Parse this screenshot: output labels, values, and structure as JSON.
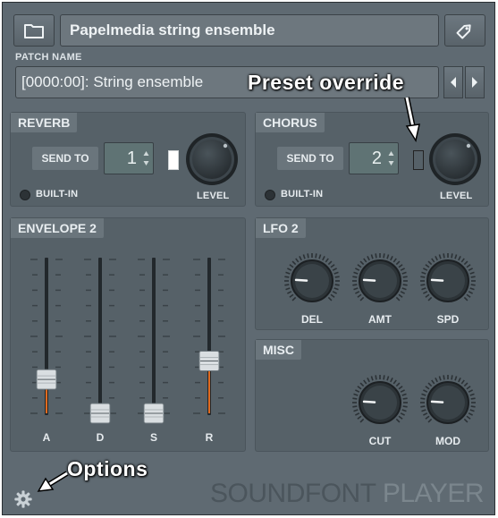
{
  "header": {
    "title": "Papelmedia string ensemble",
    "patch_label": "PATCH NAME",
    "patch_value": "[0000:00]: String ensemble",
    "folder_icon": "folder-icon",
    "tag_icon": "tag-icon",
    "prev_icon": "arrow-left-icon",
    "next_icon": "arrow-right-icon"
  },
  "reverb": {
    "title": "REVERB",
    "send_label": "SEND TO",
    "send_value": "1",
    "builtin_label": "BUILT-IN",
    "level_label": "LEVEL",
    "override_on": true
  },
  "chorus": {
    "title": "CHORUS",
    "send_label": "SEND TO",
    "send_value": "2",
    "builtin_label": "BUILT-IN",
    "level_label": "LEVEL",
    "override_on": false
  },
  "envelope": {
    "title": "ENVELOPE 2",
    "sliders": [
      {
        "label": "A",
        "level": 0.22
      },
      {
        "label": "D",
        "level": 0.0
      },
      {
        "label": "S",
        "level": 0.0
      },
      {
        "label": "R",
        "level": 0.34
      }
    ]
  },
  "lfo": {
    "title": "LFO 2",
    "knobs": [
      {
        "label": "DEL",
        "value": 0.18
      },
      {
        "label": "AMT",
        "value": 0.18
      },
      {
        "label": "SPD",
        "value": 0.18
      }
    ]
  },
  "misc": {
    "title": "MISC",
    "knobs": [
      {
        "label": "CUT",
        "value": 0.18
      },
      {
        "label": "MOD",
        "value": 0.18
      }
    ]
  },
  "annotations": {
    "preset_override": "Preset override",
    "options": "Options"
  },
  "brand": {
    "part1": "SOUNDFONT",
    "part2": "PLAYER"
  },
  "footer": {
    "options_icon": "gear-icon"
  },
  "colors": {
    "panel_bg": "#566168",
    "override_on": "#ffffff",
    "fader_accent": "#e06a1f"
  }
}
